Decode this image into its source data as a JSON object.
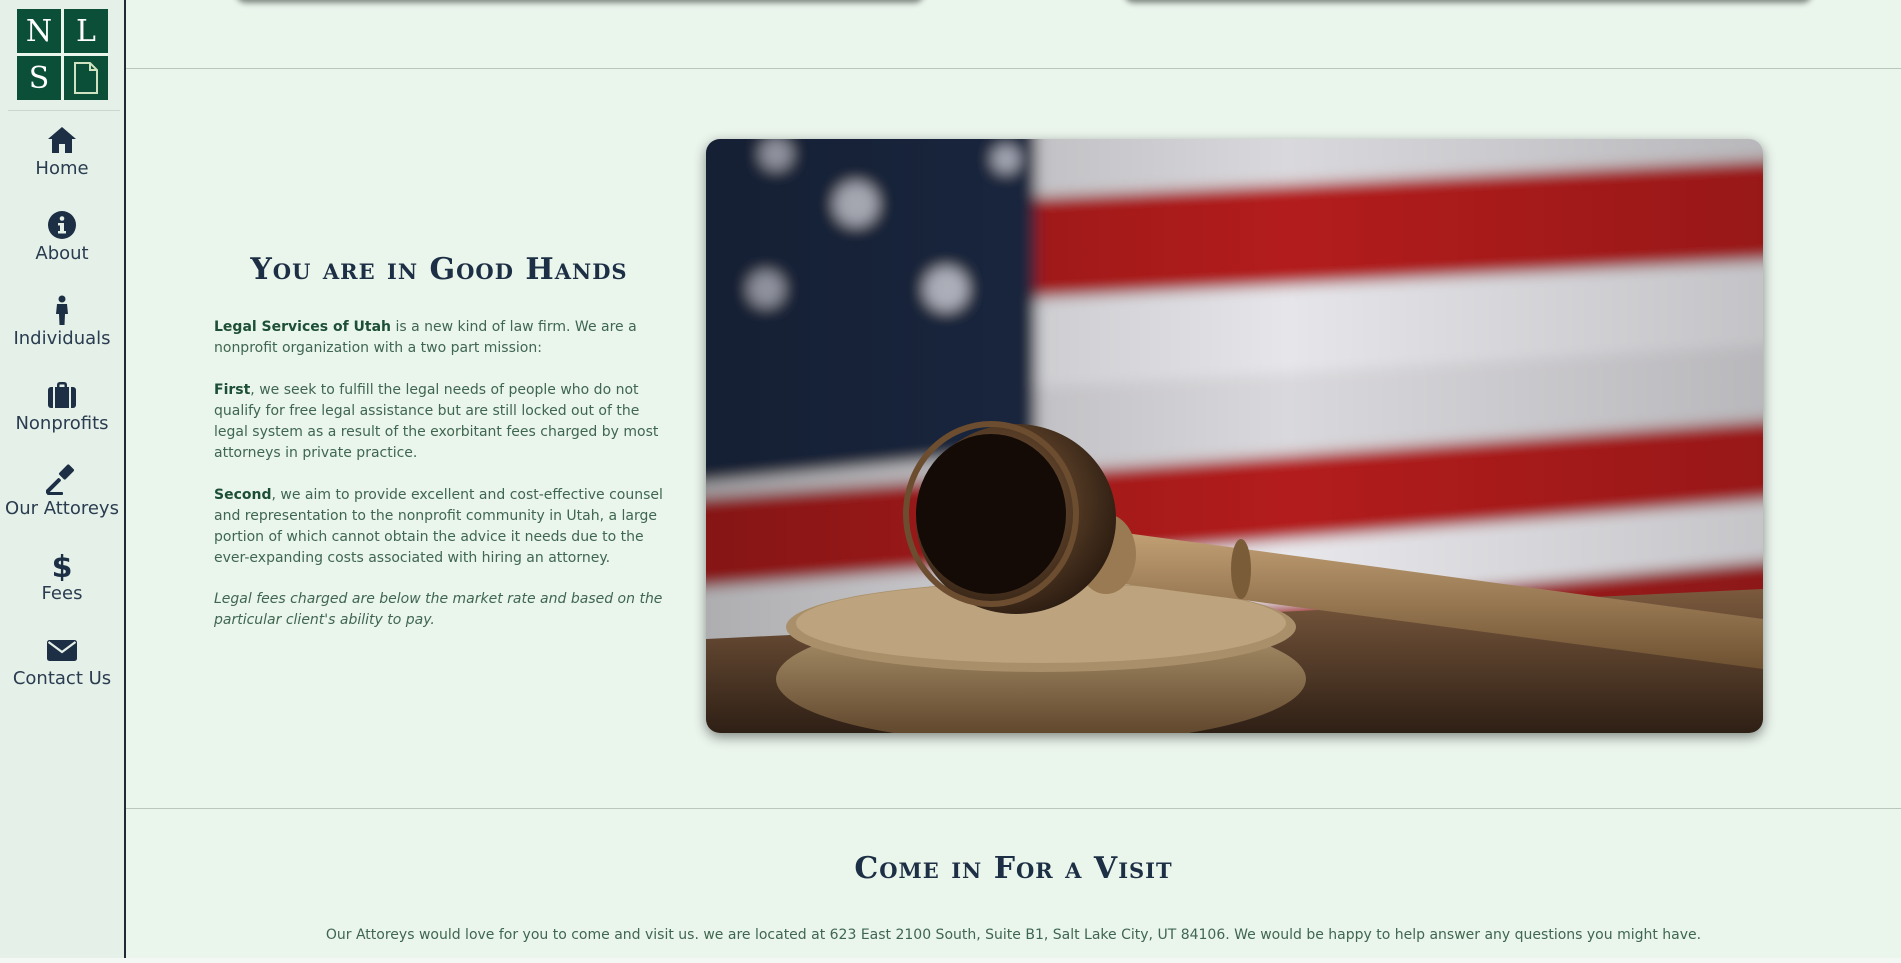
{
  "logo": {
    "letters": [
      "N",
      "L",
      "S"
    ],
    "icon": "document-icon"
  },
  "nav": [
    {
      "label": "Home",
      "icon": "home-icon"
    },
    {
      "label": "About",
      "icon": "info-icon"
    },
    {
      "label": "Individuals",
      "icon": "person-icon"
    },
    {
      "label": "Nonprofits",
      "icon": "briefcase-icon"
    },
    {
      "label": "Our Attoreys",
      "icon": "gavel-icon"
    },
    {
      "label": "Fees",
      "icon": "dollar-icon"
    },
    {
      "label": "Contact Us",
      "icon": "envelope-icon"
    }
  ],
  "intro": {
    "title": "You are in Good Hands",
    "p1_strong": "Legal Services of Utah",
    "p1_rest": " is a new kind of law firm. We are a nonprofit organization with a two part mission:",
    "p2_strong": "First",
    "p2_rest": ", we seek to fulfill the legal needs of people who do not qualify for free legal assistance but are still locked out of the legal system as a result of the exorbitant fees charged by most attorneys in private practice.",
    "p3_strong": "Second",
    "p3_rest": ", we aim to provide excellent and cost-effective counsel and representation to the nonprofit community in Utah, a large portion of which cannot obtain the advice it needs due to the ever-expanding costs associated with hiring an attorney.",
    "p4": "Legal fees charged are below the market rate and based on the particular client's ability to pay."
  },
  "visit": {
    "title": "Come in For a Visit",
    "text": "Our Attoreys would love for you to come and visit us. we are located at 623 East 2100 South, Suite B1, Salt Lake City, UT 84106. We would be happy to help answer any questions you might have."
  },
  "colors": {
    "brand_green": "#0b4f38",
    "navy": "#1d2f45",
    "text_green": "#3f6650",
    "background": "#eaf5ec"
  }
}
